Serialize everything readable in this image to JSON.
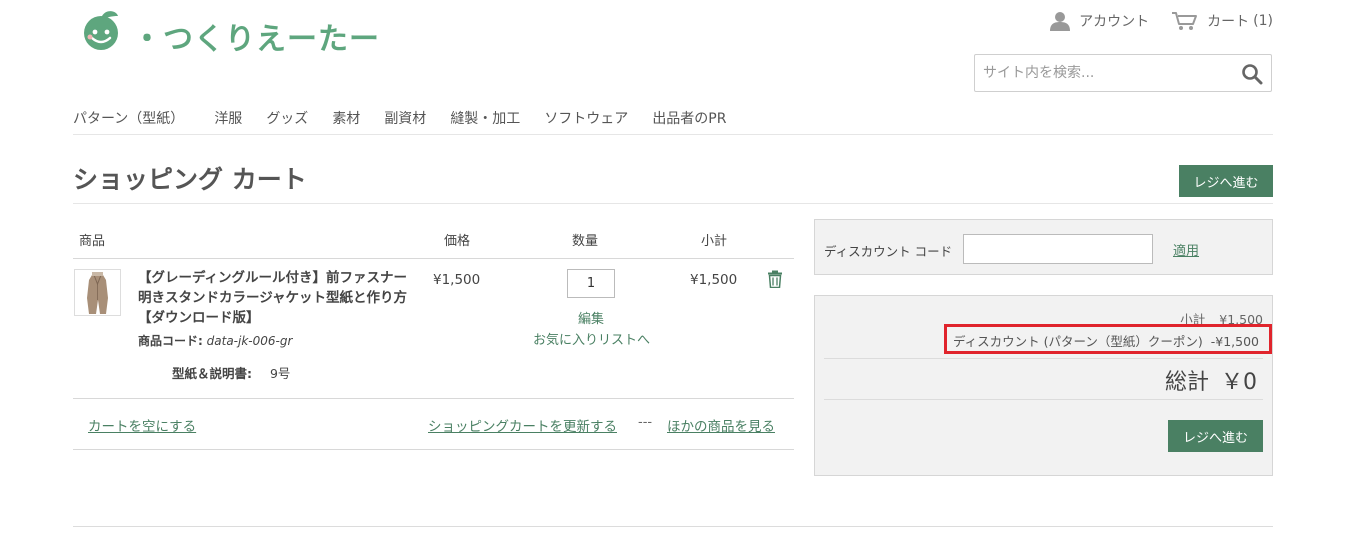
{
  "header": {
    "logo_text": "・つくりえーたー",
    "account_label": "アカウント",
    "cart_label": "カート",
    "cart_count": "(1)",
    "search_placeholder": "サイト内を検索..."
  },
  "nav": {
    "items": [
      "パターン（型紙）",
      "洋服",
      "グッズ",
      "素材",
      "副資材",
      "縫製・加工",
      "ソフトウェア",
      "出品者のPR"
    ]
  },
  "page": {
    "title": "ショッピング カート",
    "checkout_label": "レジへ進む"
  },
  "cart": {
    "columns": {
      "item": "商品",
      "price": "価格",
      "qty": "数量",
      "subtotal": "小計"
    },
    "items": [
      {
        "name": "【グレーディングルール付き】前ファスナー明きスタンドカラージャケット型紙と作り方【ダウンロード版】",
        "code_label": "商品コード:",
        "code": "data-jk-006-gr",
        "option_label": "型紙＆説明書:",
        "option_value": "9号",
        "price": "¥1,500",
        "qty": "1",
        "subtotal": "¥1,500",
        "edit_label": "編集",
        "wishlist_label": "お気に入りリストへ"
      }
    ],
    "actions": {
      "clear": "カートを空にする",
      "update": "ショッピングカートを更新する",
      "separator": "---",
      "continue": "ほかの商品を見る"
    }
  },
  "discount": {
    "label": "ディスカウント コード",
    "input_value": "",
    "apply_label": "適用"
  },
  "totals": {
    "subtotal_label": "小計",
    "subtotal_value": "¥1,500",
    "discount_label": "ディスカウント (パターン（型紙）クーポン)",
    "discount_value": "-¥1,500",
    "grand_label": "総計",
    "grand_value": "￥0",
    "checkout_label": "レジへ進む"
  },
  "colors": {
    "accent": "#4a8063",
    "logo": "#5ea67e",
    "highlight": "#e0242c"
  }
}
